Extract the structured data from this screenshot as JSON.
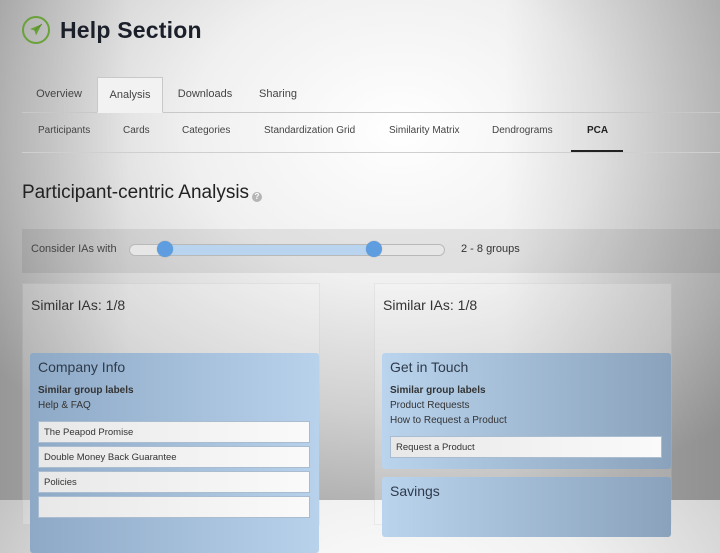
{
  "header": {
    "title": "Help Section",
    "logo_icon": "paper-plane-icon",
    "accent": "#6aa23a"
  },
  "tabs": [
    {
      "label": "Overview",
      "active": false
    },
    {
      "label": "Analysis",
      "active": true
    },
    {
      "label": "Downloads",
      "active": false
    },
    {
      "label": "Sharing",
      "active": false
    }
  ],
  "subtabs": [
    {
      "label": "Participants",
      "active": false
    },
    {
      "label": "Cards",
      "active": false
    },
    {
      "label": "Categories",
      "active": false
    },
    {
      "label": "Standardization Grid",
      "active": false
    },
    {
      "label": "Similarity Matrix",
      "active": false
    },
    {
      "label": "Dendrograms",
      "active": false
    },
    {
      "label": "PCA",
      "active": true
    }
  ],
  "section": {
    "title": "Participant-centric Analysis",
    "help_icon": "?"
  },
  "filter": {
    "label": "Consider IAs with",
    "range_min": 2,
    "range_max": 8,
    "range_text": "2 - 8 groups",
    "slider_color": "#5e9ee0"
  },
  "panels": [
    {
      "title": "Similar IAs: 1/8",
      "groups": [
        {
          "title": "Company Info",
          "labels_heading": "Similar group labels",
          "labels": [
            "Help & FAQ"
          ],
          "cards": [
            "The Peapod Promise",
            "Double Money Back Guarantee",
            "Policies",
            ""
          ]
        }
      ]
    },
    {
      "title": "Similar IAs: 1/8",
      "groups": [
        {
          "title": "Get in Touch",
          "labels_heading": "Similar group labels",
          "labels": [
            "Product Requests",
            "How to Request a Product"
          ],
          "cards": [
            "Request a Product"
          ]
        },
        {
          "title": "Savings"
        }
      ]
    }
  ]
}
